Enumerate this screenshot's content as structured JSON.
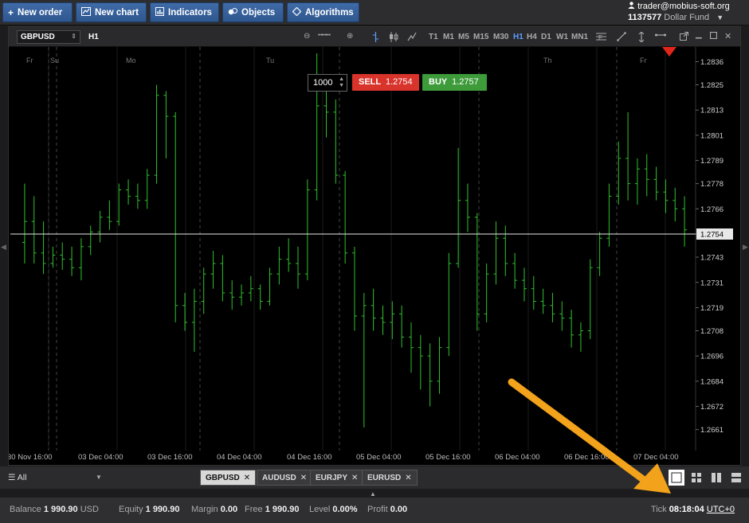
{
  "toolbar": {
    "new_order": "New order",
    "new_chart": "New chart",
    "indicators": "Indicators",
    "objects": "Objects",
    "algorithms": "Algorithms"
  },
  "user": {
    "email": "trader@mobius-soft.org",
    "account": "1137577",
    "fund": "Dollar Fund"
  },
  "chart_window": {
    "symbol": "GBPUSD",
    "timeframe": "H1",
    "timeframes": [
      "T1",
      "M1",
      "M5",
      "M15",
      "M30",
      "H1",
      "H4",
      "D1",
      "W1",
      "MN1"
    ],
    "active_timeframe": "H1",
    "quantity": "1000",
    "sell_label": "SELL",
    "sell_price": "1.2754",
    "buy_label": "BUY",
    "buy_price": "1.2757"
  },
  "chart_data": {
    "type": "ohlc",
    "symbol": "GBPUSD",
    "timeframe": "H1",
    "y_ticks": [
      1.2836,
      1.2825,
      1.2813,
      1.2801,
      1.2789,
      1.2778,
      1.2766,
      1.2754,
      1.2743,
      1.2731,
      1.2719,
      1.2708,
      1.2696,
      1.2684,
      1.2672,
      1.2661
    ],
    "x_labels": [
      "30 Nov 16:00",
      "03 Dec 04:00",
      "03 Dec 16:00",
      "04 Dec 04:00",
      "04 Dec 16:00",
      "05 Dec 04:00",
      "05 Dec 16:00",
      "06 Dec 04:00",
      "06 Dec 16:00",
      "07 Dec 04:00"
    ],
    "day_labels": [
      "Fr",
      "Su",
      "Mo",
      "Tu",
      "Th",
      "Fr"
    ],
    "ylim": [
      1.2651,
      1.2843
    ],
    "current_price": 1.2754,
    "grid": true,
    "bar_color": "#2fc12f",
    "bars": [
      [
        1.275,
        1.2778,
        1.274,
        1.276
      ],
      [
        1.276,
        1.2772,
        1.274,
        1.2745
      ],
      [
        1.2745,
        1.276,
        1.2735,
        1.274
      ],
      [
        1.274,
        1.2748,
        1.2738,
        1.2744
      ],
      [
        1.2744,
        1.275,
        1.2737,
        1.2742
      ],
      [
        1.2742,
        1.2748,
        1.2734,
        1.2738
      ],
      [
        1.2738,
        1.2752,
        1.2732,
        1.2748
      ],
      [
        1.2748,
        1.2758,
        1.2744,
        1.2755
      ],
      [
        1.2755,
        1.2765,
        1.275,
        1.2762
      ],
      [
        1.2762,
        1.277,
        1.2756,
        1.276
      ],
      [
        1.276,
        1.2778,
        1.2758,
        1.2775
      ],
      [
        1.2775,
        1.278,
        1.2768,
        1.2772
      ],
      [
        1.2772,
        1.2778,
        1.2766,
        1.277
      ],
      [
        1.277,
        1.2785,
        1.2766,
        1.2782
      ],
      [
        1.2782,
        1.2825,
        1.2778,
        1.282
      ],
      [
        1.282,
        1.2822,
        1.279,
        1.281
      ],
      [
        1.281,
        1.2812,
        1.2712,
        1.272
      ],
      [
        1.272,
        1.2726,
        1.2708,
        1.2712
      ],
      [
        1.2712,
        1.2728,
        1.2698,
        1.2722
      ],
      [
        1.2722,
        1.2738,
        1.2716,
        1.2735
      ],
      [
        1.2735,
        1.2746,
        1.2728,
        1.274
      ],
      [
        1.274,
        1.2744,
        1.2722,
        1.2726
      ],
      [
        1.2726,
        1.2732,
        1.2718,
        1.2724
      ],
      [
        1.2724,
        1.273,
        1.272,
        1.2726
      ],
      [
        1.2726,
        1.2734,
        1.2722,
        1.2728
      ],
      [
        1.2728,
        1.273,
        1.2718,
        1.2722
      ],
      [
        1.2722,
        1.2738,
        1.272,
        1.2735
      ],
      [
        1.2735,
        1.2748,
        1.273,
        1.2742
      ],
      [
        1.2742,
        1.2752,
        1.2736,
        1.274
      ],
      [
        1.274,
        1.2748,
        1.2728,
        1.2735
      ],
      [
        1.2735,
        1.278,
        1.2732,
        1.2775
      ],
      [
        1.2775,
        1.284,
        1.277,
        1.2815
      ],
      [
        1.2815,
        1.2828,
        1.28,
        1.2812
      ],
      [
        1.2812,
        1.2818,
        1.2778,
        1.2782
      ],
      [
        1.2782,
        1.2784,
        1.274,
        1.2745
      ],
      [
        1.2745,
        1.2748,
        1.2708,
        1.2715
      ],
      [
        1.2715,
        1.2726,
        1.2662,
        1.272
      ],
      [
        1.272,
        1.2728,
        1.2708,
        1.2714
      ],
      [
        1.2714,
        1.272,
        1.2706,
        1.2712
      ],
      [
        1.2712,
        1.2722,
        1.2704,
        1.2716
      ],
      [
        1.2716,
        1.272,
        1.27,
        1.2705
      ],
      [
        1.2705,
        1.2712,
        1.2688,
        1.27
      ],
      [
        1.27,
        1.2706,
        1.268,
        1.2696
      ],
      [
        1.2696,
        1.2702,
        1.2672,
        1.2684
      ],
      [
        1.2684,
        1.2705,
        1.2678,
        1.27
      ],
      [
        1.27,
        1.2745,
        1.2696,
        1.274
      ],
      [
        1.274,
        1.2795,
        1.2738,
        1.277
      ],
      [
        1.277,
        1.2778,
        1.2755,
        1.2762
      ],
      [
        1.2762,
        1.2764,
        1.2708,
        1.2716
      ],
      [
        1.2716,
        1.274,
        1.2712,
        1.2735
      ],
      [
        1.2735,
        1.276,
        1.273,
        1.2752
      ],
      [
        1.2752,
        1.2758,
        1.2734,
        1.274
      ],
      [
        1.274,
        1.2745,
        1.2728,
        1.2732
      ],
      [
        1.2732,
        1.2738,
        1.2722,
        1.2728
      ],
      [
        1.2728,
        1.2734,
        1.2718,
        1.2722
      ],
      [
        1.2722,
        1.2728,
        1.2716,
        1.272
      ],
      [
        1.272,
        1.2726,
        1.2712,
        1.2716
      ],
      [
        1.2716,
        1.2722,
        1.2708,
        1.2714
      ],
      [
        1.2714,
        1.2718,
        1.27,
        1.2706
      ],
      [
        1.2706,
        1.2712,
        1.2698,
        1.2708
      ],
      [
        1.2708,
        1.2742,
        1.2704,
        1.2738
      ],
      [
        1.2738,
        1.2755,
        1.2734,
        1.2752
      ],
      [
        1.2752,
        1.2778,
        1.2748,
        1.2772
      ],
      [
        1.2772,
        1.2798,
        1.2768,
        1.279
      ],
      [
        1.279,
        1.2812,
        1.277,
        1.2778
      ],
      [
        1.2778,
        1.279,
        1.2768,
        1.2785
      ],
      [
        1.2785,
        1.2792,
        1.2772,
        1.278
      ],
      [
        1.278,
        1.2786,
        1.277,
        1.2774
      ],
      [
        1.2774,
        1.278,
        1.2764,
        1.277
      ],
      [
        1.277,
        1.2776,
        1.276,
        1.2766
      ],
      [
        1.2766,
        1.2772,
        1.2748,
        1.2756
      ]
    ]
  },
  "tabs_bar": {
    "filter": "All",
    "symbols": [
      "GBPUSD",
      "AUDUSD",
      "EURJPY",
      "EURUSD"
    ],
    "active_symbol": "GBPUSD"
  },
  "status": {
    "balance_label": "Balance",
    "balance_value": "1 990.90",
    "balance_currency": "USD",
    "equity_label": "Equity",
    "equity_value": "1 990.90",
    "margin_label": "Margin",
    "margin_value": "0.00",
    "free_label": "Free",
    "free_value": "1 990.90",
    "level_label": "Level",
    "level_value": "0.00%",
    "profit_label": "Profit",
    "profit_value": "0.00",
    "tick_label": "Tick",
    "tick_time": "08:18:04",
    "timezone": "UTC+0"
  }
}
